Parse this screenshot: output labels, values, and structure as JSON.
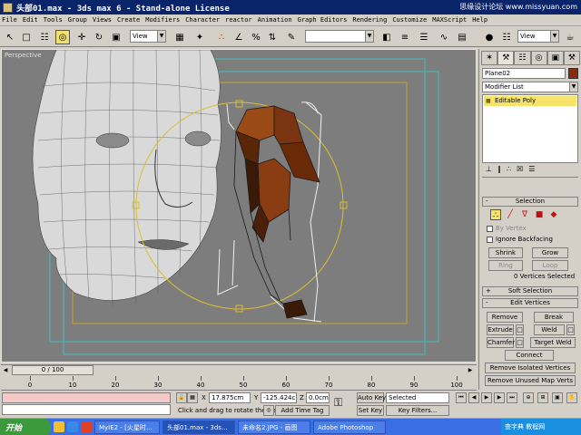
{
  "window": {
    "title": "头部01.max - 3ds max 6 - Stand-alone License",
    "watermark": "思缘设计论坛 www.missyuan.com"
  },
  "menu": [
    "File",
    "Edit",
    "Tools",
    "Group",
    "Views",
    "Create",
    "Modifiers",
    "Character",
    "reactor",
    "Animation",
    "Graph Editors",
    "Rendering",
    "Customize",
    "MAXScript",
    "Help"
  ],
  "toolbar": {
    "ref_coord": "View",
    "named_selection": "",
    "right_view": "View"
  },
  "viewport": {
    "label": "Perspective"
  },
  "command_panel": {
    "object_name": "Plane02",
    "object_color": "#8b2b0b",
    "modifier_list": "Modifier List",
    "stack_item": "Editable Poly",
    "selection_rollout": "Selection",
    "by_vertex": "By Vertex",
    "ignore_backfacing": "Ignore Backfacing",
    "shrink": "Shrink",
    "grow": "Grow",
    "ring": "Ring",
    "loop": "Loop",
    "selection_status": "0 Vertices Selected",
    "soft_selection": "Soft Selection",
    "edit_vertices": "Edit Vertices",
    "remove": "Remove",
    "break": "Break",
    "extrude": "Extrude",
    "weld": "Weld",
    "chamfer": "Chamfer",
    "target_weld": "Target Weld",
    "connect": "Connect",
    "remove_isolated": "Remove Isolated Vertices",
    "remove_unused": "Remove Unused Map Verts"
  },
  "timeline": {
    "frame_display": "0 / 100",
    "ticks": [
      "0",
      "10",
      "20",
      "30",
      "40",
      "50",
      "60",
      "70",
      "80",
      "90",
      "100"
    ]
  },
  "status": {
    "prompt": "Click and drag to rotate the view.",
    "add_time_tag": "Add Time Tag",
    "x_label": "X",
    "x_value": "17.875cm",
    "y_label": "Y",
    "y_value": "-125.424cr",
    "z_label": "Z",
    "z_value": "0.0cm",
    "auto_key": "Auto Key",
    "set_key": "Set Key",
    "selected": "Selected",
    "key_filters": "Key Filters..."
  },
  "taskbar": {
    "start": "开始",
    "tasks": [
      "MyIE2 - [火星时...",
      "头部01.max - 3ds...",
      "未命名2.JPG - 画图",
      "Adobe Photoshop"
    ],
    "tray_watermark": "查字典 教程网"
  }
}
